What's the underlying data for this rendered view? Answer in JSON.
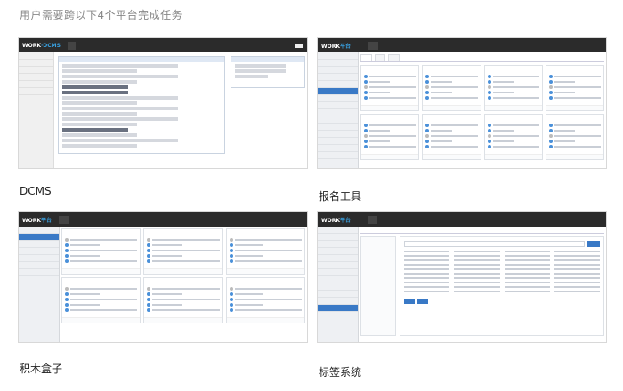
{
  "page_title": "用户需要跨以下4个平台完成任务",
  "panels": [
    {
      "caption": "DCMS",
      "logo": "WORK平台 · DCMS"
    },
    {
      "caption": "报名工具",
      "logo": "WORK平台"
    },
    {
      "caption": "积木盒子",
      "logo": "WORK平台"
    },
    {
      "caption": "标签系统",
      "logo": "WORK平台"
    }
  ]
}
